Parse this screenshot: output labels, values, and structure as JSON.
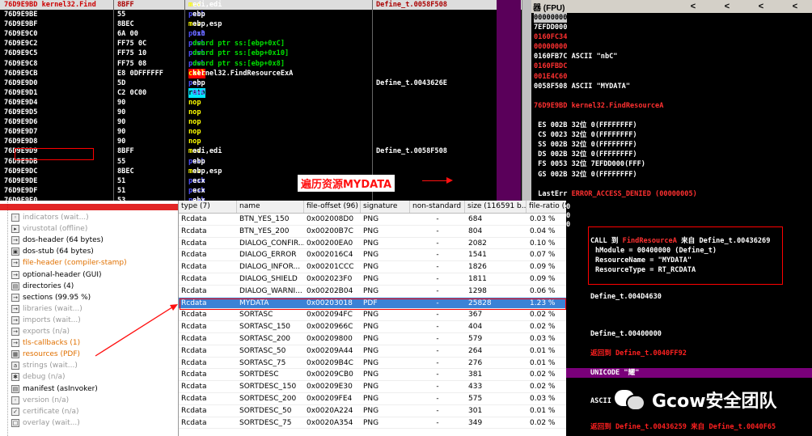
{
  "disasm": [
    {
      "addr": "76D9E9BD kernel32.Find",
      "hex": "8BFF",
      "op": "mov",
      "args": "edi,edi",
      "cmt": "Define_t.0058F508",
      "op_class": "kw-mov",
      "sel": true
    },
    {
      "addr": "76D9E9BE",
      "hex": "55",
      "op": "push",
      "args": "ebp",
      "cmt": "",
      "op_class": "kw-push"
    },
    {
      "addr": "76D9E9BF",
      "hex": "8BEC",
      "op": "mov",
      "args": "ebp,esp",
      "cmt": "",
      "op_class": "kw-mov"
    },
    {
      "addr": "76D9E9C0",
      "hex": "6A 00",
      "op": "push",
      "args": "0x0",
      "cmt": "",
      "op_class": "kw-push",
      "args_class": "opnd-blue"
    },
    {
      "addr": "76D9E9C2",
      "hex": "FF75 0C",
      "op": "push",
      "args": "dword ptr ss:[ebp+0xC]",
      "cmt": "",
      "op_class": "kw-push",
      "args_class": "opnd-green"
    },
    {
      "addr": "76D9E9C5",
      "hex": "FF75 10",
      "op": "push",
      "args": "dword ptr ss:[ebp+0x10]",
      "cmt": "",
      "op_class": "kw-push",
      "args_class": "opnd-green"
    },
    {
      "addr": "76D9E9C8",
      "hex": "FF75 08",
      "op": "push",
      "args": "dword ptr ss:[ebp+0x8]",
      "cmt": "",
      "op_class": "kw-push",
      "args_class": "opnd-green"
    },
    {
      "addr": "76D9E9CB",
      "hex": "E8 0DFFFFFF",
      "op": "call",
      "args": "kernel32.FindResourceExA",
      "cmt": "",
      "op_class": "kw-call"
    },
    {
      "addr": "76D9E9D0",
      "hex": "5D",
      "op": "pop",
      "args": "ebp",
      "cmt": "Define_t.0043626E",
      "op_class": "kw-push"
    },
    {
      "addr": "76D9E9D1",
      "hex": "C2 0C00",
      "op": "retn",
      "args": "0xC",
      "cmt": "",
      "op_class": "kw-retn",
      "args_class": "opnd-blue"
    },
    {
      "addr": "76D9E9D4",
      "hex": "90",
      "op": "nop",
      "args": "",
      "cmt": "",
      "op_class": "kw-nop"
    },
    {
      "addr": "76D9E9D5",
      "hex": "90",
      "op": "nop",
      "args": "",
      "cmt": "",
      "op_class": "kw-nop"
    },
    {
      "addr": "76D9E9D6",
      "hex": "90",
      "op": "nop",
      "args": "",
      "cmt": "",
      "op_class": "kw-nop"
    },
    {
      "addr": "76D9E9D7",
      "hex": "90",
      "op": "nop",
      "args": "",
      "cmt": "",
      "op_class": "kw-nop"
    },
    {
      "addr": "76D9E9D8",
      "hex": "90",
      "op": "nop",
      "args": "",
      "cmt": "",
      "op_class": "kw-nop"
    },
    {
      "addr": "76D9E9D9",
      "hex": "8BFF",
      "op": "mov",
      "args": "edi,edi",
      "cmt": "Define_t.0058F508",
      "op_class": "kw-mov"
    },
    {
      "addr": "76D9E9DB",
      "hex": "55",
      "op": "push",
      "args": "ebp",
      "cmt": "",
      "op_class": "kw-push"
    },
    {
      "addr": "76D9E9DC",
      "hex": "8BEC",
      "op": "mov",
      "args": "ebp,esp",
      "cmt": "",
      "op_class": "kw-mov"
    },
    {
      "addr": "76D9E9DE",
      "hex": "51",
      "op": "push",
      "args": "ecx",
      "cmt": "",
      "op_class": "kw-push"
    },
    {
      "addr": "76D9E9DF",
      "hex": "51",
      "op": "push",
      "args": "ecx",
      "cmt": "",
      "op_class": "kw-push"
    },
    {
      "addr": "76D9E9E0",
      "hex": "53",
      "op": "push",
      "args": "ebx",
      "cmt": "",
      "op_class": "kw-push"
    }
  ],
  "registers": {
    "header": "器 (FPU)",
    "arrows": [
      "<",
      "<",
      "<",
      "<"
    ],
    "rows": [
      {
        "t": "00000000",
        "c": "rgray"
      },
      {
        "t": "7EFDD000",
        "c": ""
      },
      {
        "t": "0160FC34",
        "c": "rred"
      },
      {
        "t": "00000000",
        "c": "rred"
      },
      {
        "t": "0160FB7C ASCII \"nbC\"",
        "c": ""
      },
      {
        "t": "0160FBDC",
        "c": "rred"
      },
      {
        "t": "001E4C60",
        "c": "rred"
      },
      {
        "t": "0058F508 ASCII \"MYDATA\"",
        "c": ""
      },
      {
        "t": "",
        "c": ""
      },
      {
        "t": "76D9E9BD kernel32.FindResourceA",
        "c": ""
      },
      {
        "t": "",
        "c": ""
      },
      {
        "t": " ES 002B 32位 0(FFFFFFFF)",
        "c": ""
      },
      {
        "t": " CS 0023 32位 0(FFFFFFFF)",
        "c": ""
      },
      {
        "t": " SS 002B 32位 0(FFFFFFFF)",
        "c": ""
      },
      {
        "t": " DS 002B 32位 0(FFFFFFFF)",
        "c": ""
      },
      {
        "t": " FS 0053 32位 7EFDD000(FFF)",
        "c": ""
      },
      {
        "t": " GS 002B 32位 0(FFFFFFFF)",
        "c": ""
      },
      {
        "t": "",
        "c": ""
      },
      {
        "t": " LastErr ERROR_ACCESS_DENIED (00000005)",
        "c": ""
      },
      {
        "t": "",
        "c": ""
      },
      {
        "t": "00000246 (NO,NB,E,BE,NS,PE,GE,LE)",
        "c": ""
      }
    ]
  },
  "annotation_text": "遍历资源MYDATA",
  "tree": {
    "items": [
      {
        "label": "indicators (wait...)",
        "cls": "gray",
        "icon": "indicator-icon"
      },
      {
        "label": "virustotal (offline)",
        "cls": "gray",
        "icon": "virustotal-icon"
      },
      {
        "label": "dos-header (64 bytes)",
        "cls": "",
        "icon": "arrow-icon"
      },
      {
        "label": "dos-stub (64 bytes)",
        "cls": "",
        "icon": "dos-icon"
      },
      {
        "label": "file-header (compiler-stamp)",
        "cls": "orange",
        "icon": "arrow-icon"
      },
      {
        "label": "optional-header (GUI)",
        "cls": "",
        "icon": "arrow-icon"
      },
      {
        "label": "directories (4)",
        "cls": "",
        "icon": "directory-icon"
      },
      {
        "label": "sections (99.95 %)",
        "cls": "",
        "icon": "arrow-icon"
      },
      {
        "label": "libraries (wait...)",
        "cls": "gray",
        "icon": "arrow-icon"
      },
      {
        "label": "imports (wait...)",
        "cls": "gray",
        "icon": "arrow-icon"
      },
      {
        "label": "exports (n/a)",
        "cls": "gray",
        "icon": "arrow-icon"
      },
      {
        "label": "tls-callbacks (1)",
        "cls": "orange",
        "icon": "arrow-icon"
      },
      {
        "label": "resources (PDF)",
        "cls": "orange",
        "icon": "resource-icon"
      },
      {
        "label": "strings (wait...)",
        "cls": "gray",
        "icon": "strings-icon"
      },
      {
        "label": "debug (n/a)",
        "cls": "gray",
        "icon": "debug-icon"
      },
      {
        "label": "manifest (asInvoker)",
        "cls": "",
        "icon": "manifest-icon"
      },
      {
        "label": "version (n/a)",
        "cls": "gray",
        "icon": "version-icon"
      },
      {
        "label": "certificate (n/a)",
        "cls": "gray",
        "icon": "certificate-icon"
      },
      {
        "label": "overlay (wait...)",
        "cls": "gray",
        "icon": "overlay-icon"
      }
    ]
  },
  "table": {
    "headers": [
      "type (7)",
      "name",
      "file-offset (96)",
      "signature",
      "non-standard",
      "size (116591 b...",
      "file-ratio (5"
    ],
    "rows": [
      [
        "Rcdata",
        "BTN_YES_150",
        "0x002008D0",
        "PNG",
        "-",
        "684",
        "0.03 %"
      ],
      [
        "Rcdata",
        "BTN_YES_200",
        "0x00200B7C",
        "PNG",
        "-",
        "804",
        "0.04 %"
      ],
      [
        "Rcdata",
        "DIALOG_CONFIR...",
        "0x00200EA0",
        "PNG",
        "-",
        "2082",
        "0.10 %"
      ],
      [
        "Rcdata",
        "DIALOG_ERROR",
        "0x002016C4",
        "PNG",
        "-",
        "1541",
        "0.07 %"
      ],
      [
        "Rcdata",
        "DIALOG_INFOR...",
        "0x00201CCC",
        "PNG",
        "-",
        "1826",
        "0.09 %"
      ],
      [
        "Rcdata",
        "DIALOG_SHIELD",
        "0x002023F0",
        "PNG",
        "-",
        "1811",
        "0.09 %"
      ],
      [
        "Rcdata",
        "DIALOG_WARNI...",
        "0x00202B04",
        "PNG",
        "-",
        "1298",
        "0.06 %"
      ],
      [
        "Rcdata",
        "MYDATA",
        "0x00203018",
        "PDF",
        "-",
        "25828",
        "1.23 %"
      ],
      [
        "Rcdata",
        "SORTASC",
        "0x002094FC",
        "PNG",
        "-",
        "367",
        "0.02 %"
      ],
      [
        "Rcdata",
        "SORTASC_150",
        "0x0020966C",
        "PNG",
        "-",
        "404",
        "0.02 %"
      ],
      [
        "Rcdata",
        "SORTASC_200",
        "0x00209800",
        "PNG",
        "-",
        "579",
        "0.03 %"
      ],
      [
        "Rcdata",
        "SORTASC_50",
        "0x00209A44",
        "PNG",
        "-",
        "264",
        "0.01 %"
      ],
      [
        "Rcdata",
        "SORTASC_75",
        "0x00209B4C",
        "PNG",
        "-",
        "276",
        "0.01 %"
      ],
      [
        "Rcdata",
        "SORTDESC",
        "0x00209CB0",
        "PNG",
        "-",
        "381",
        "0.02 %"
      ],
      [
        "Rcdata",
        "SORTDESC_150",
        "0x00209E30",
        "PNG",
        "-",
        "433",
        "0.02 %"
      ],
      [
        "Rcdata",
        "SORTDESC_200",
        "0x00209FE4",
        "PNG",
        "-",
        "575",
        "0.03 %"
      ],
      [
        "Rcdata",
        "SORTDESC_50",
        "0x0020A224",
        "PNG",
        "-",
        "301",
        "0.01 %"
      ],
      [
        "Rcdata",
        "SORTDESC_75",
        "0x0020A354",
        "PNG",
        "-",
        "349",
        "0.02 %"
      ]
    ],
    "highlight_index": 7
  },
  "stack": {
    "call_lines": [
      "CALL 到 FindResourceA 来自 Define_t.00436269",
      "hModule = 00400000 (Define_t)",
      "ResourceName = \"MYDATA\"",
      "ResourceType = RT_RCDATA"
    ],
    "lines": [
      {
        "t": "Define_t.004D4630",
        "c": ""
      },
      {
        "t": "Define_t.00400000",
        "c": ""
      },
      {
        "t": "返回到 Define_t.0040FF92",
        "c": "red"
      },
      {
        "t": "UNICODE \"耀\"",
        "c": ""
      },
      {
        "t": "ASCII",
        "c": ""
      },
      {
        "t": "返回到 Define_t.00436259 来自 Define_t.0040F65",
        "c": "red"
      }
    ],
    "side_values": [
      "0",
      "0",
      "0"
    ]
  },
  "watermark": "Gcow安全团队"
}
